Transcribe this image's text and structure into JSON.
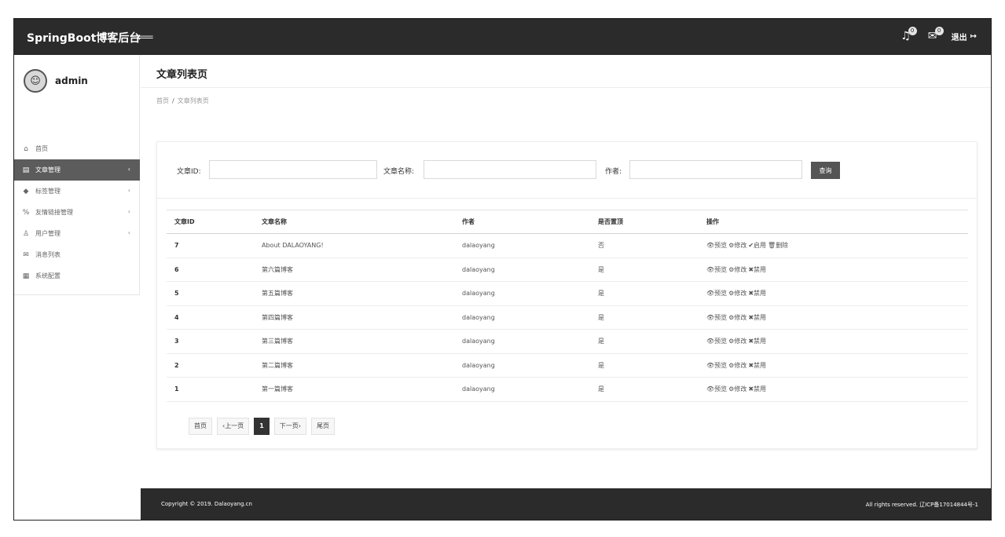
{
  "header": {
    "brand": "SpringBoot博客后台",
    "notifications_badge": "0",
    "messages_badge": "0",
    "logout_label": "退出"
  },
  "sidebar": {
    "username": "admin",
    "items": [
      {
        "label": "首页",
        "icon": "home-icon"
      },
      {
        "label": "文章管理",
        "icon": "article-icon",
        "active": true
      },
      {
        "label": "标签管理",
        "icon": "tag-icon"
      },
      {
        "label": "友情链接管理",
        "icon": "link-icon"
      },
      {
        "label": "用户管理",
        "icon": "user-icon"
      },
      {
        "label": "消息列表",
        "icon": "message-icon"
      },
      {
        "label": "系统配置",
        "icon": "settings-icon"
      }
    ]
  },
  "page": {
    "title": "文章列表页",
    "breadcrumb": [
      "首页",
      "文章列表页"
    ]
  },
  "search": {
    "id_label": "文章ID:",
    "title_label": "文章名称:",
    "author_label": "作者:",
    "id_value": "",
    "title_value": "",
    "author_value": "",
    "button": "查询"
  },
  "table": {
    "headers": [
      "文章ID",
      "文章名称",
      "作者",
      "是否置顶",
      "操作"
    ],
    "rows": [
      {
        "id": "7",
        "title": "About DALAOYANG!",
        "author": "dalaoyang",
        "top": "否",
        "ops": [
          "👁预览",
          "⚙修改",
          "✔启用",
          "🗑删除"
        ]
      },
      {
        "id": "6",
        "title": "第六篇博客",
        "author": "dalaoyang",
        "top": "是",
        "ops": [
          "👁预览",
          "⚙修改",
          "✖禁用"
        ]
      },
      {
        "id": "5",
        "title": "第五篇博客",
        "author": "dalaoyang",
        "top": "是",
        "ops": [
          "👁预览",
          "⚙修改",
          "✖禁用"
        ]
      },
      {
        "id": "4",
        "title": "第四篇博客",
        "author": "dalaoyang",
        "top": "是",
        "ops": [
          "👁预览",
          "⚙修改",
          "✖禁用"
        ]
      },
      {
        "id": "3",
        "title": "第三篇博客",
        "author": "dalaoyang",
        "top": "是",
        "ops": [
          "👁预览",
          "⚙修改",
          "✖禁用"
        ]
      },
      {
        "id": "2",
        "title": "第二篇博客",
        "author": "dalaoyang",
        "top": "是",
        "ops": [
          "👁预览",
          "⚙修改",
          "✖禁用"
        ]
      },
      {
        "id": "1",
        "title": "第一篇博客",
        "author": "dalaoyang",
        "top": "是",
        "ops": [
          "👁预览",
          "⚙修改",
          "✖禁用"
        ]
      }
    ]
  },
  "pager": {
    "first": "首页",
    "prev": "‹上一页",
    "current": "1",
    "next": "下一页›",
    "last": "尾页"
  },
  "footer": {
    "copyright": "Copyright © 2019. Dalaoyang.cn",
    "rights": "All rights reserved. 辽ICP备17014844号-1"
  }
}
